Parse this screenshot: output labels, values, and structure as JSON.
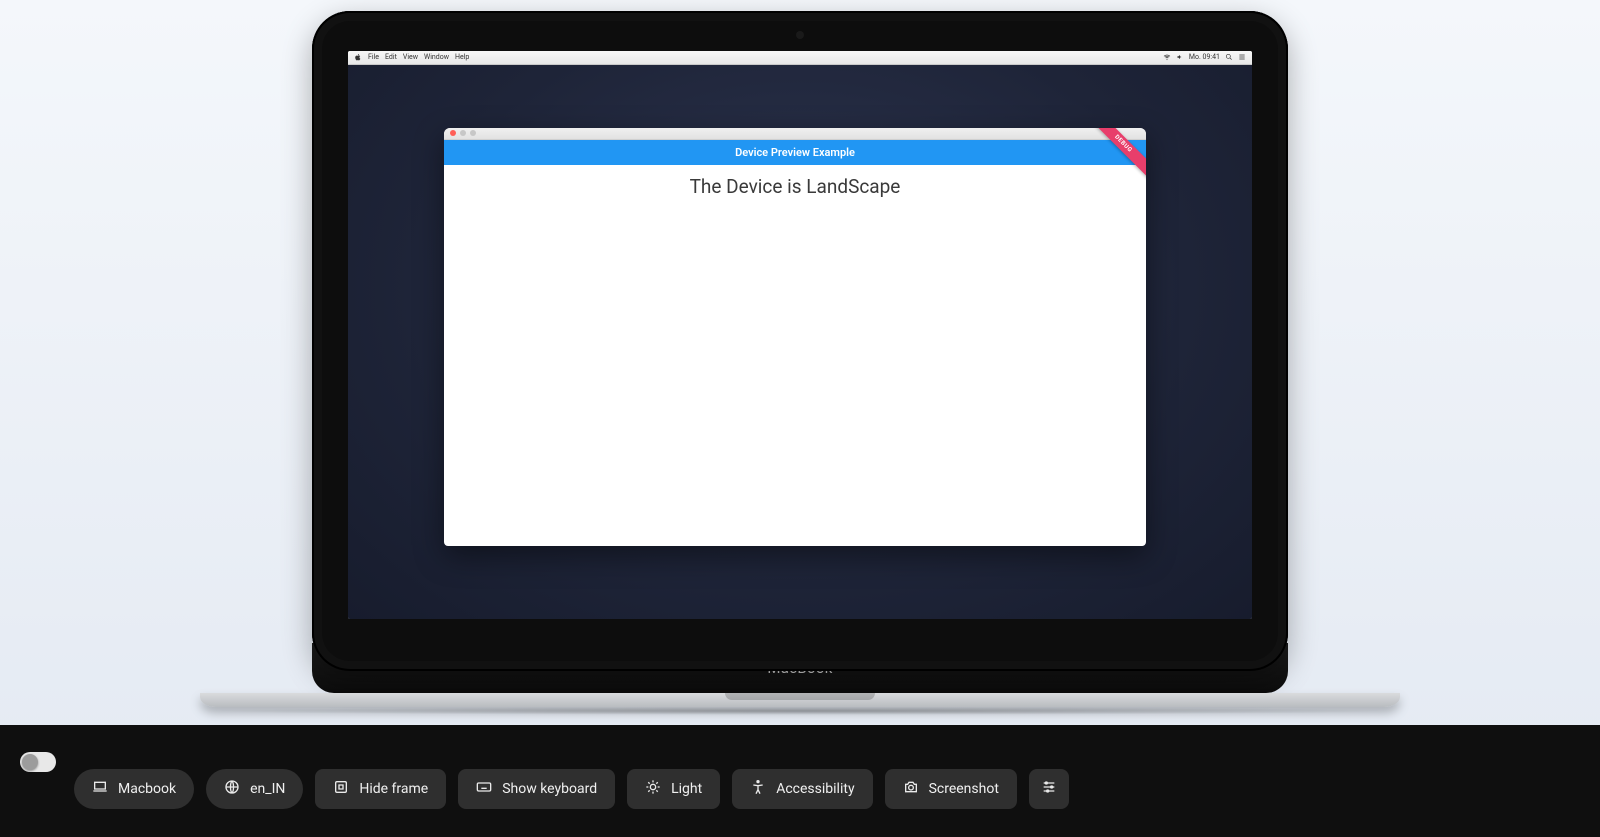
{
  "device": {
    "label": "MacBook"
  },
  "menubar": {
    "items": {
      "i0": "File",
      "i1": "Edit",
      "i2": "View",
      "i3": "Window",
      "i4": "Help"
    },
    "clock": "Mo. 09:41"
  },
  "app": {
    "title": "Device Preview Example",
    "body_text": "The Device is LandScape",
    "ribbon": "DEBUG"
  },
  "toolbar": {
    "device": "Macbook",
    "locale": "en_IN",
    "hide_frame": "Hide frame",
    "show_keyboard": "Show keyboard",
    "theme": "Light",
    "accessibility": "Accessibility",
    "screenshot": "Screenshot"
  },
  "colors": {
    "accent": "#2196f3"
  }
}
